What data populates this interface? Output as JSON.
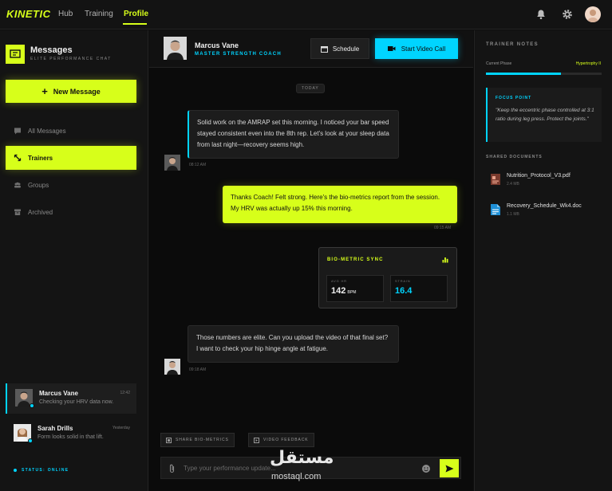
{
  "topbar": {
    "logo": "KINETIC",
    "nav": [
      {
        "label": "Hub"
      },
      {
        "label": "Training"
      },
      {
        "label": "Profile"
      }
    ]
  },
  "sidebar": {
    "title": "Messages",
    "subtitle": "ELITE PERFORMANCE CHAT",
    "new_message": "New Message",
    "items": [
      {
        "label": "All Messages",
        "icon": "chat-icon"
      },
      {
        "label": "Trainers",
        "icon": "arrows-diagonal-icon"
      },
      {
        "label": "Groups",
        "icon": "groups-icon"
      },
      {
        "label": "Archived",
        "icon": "archive-icon"
      }
    ],
    "conversations": [
      {
        "name": "Marcus Vane",
        "time": "12:42",
        "preview": "Checking your HRV data now."
      },
      {
        "name": "Sarah Drills",
        "time": "Yesterday",
        "preview": "Form looks solid in that lift."
      }
    ],
    "status": "STATUS: ONLINE"
  },
  "chat": {
    "header": {
      "name": "Marcus Vane",
      "role": "MASTER STRENGTH COACH",
      "schedule": "Schedule",
      "video": "Start Video Call"
    },
    "day_label": "TODAY",
    "messages": [
      {
        "text": "Solid work on the AMRAP set this morning. I noticed your bar speed stayed consistent even into the 8th rep. Let's look at your sleep data from last night—recovery seems high.",
        "time": "08:12 AM"
      },
      {
        "text": "Thanks Coach! Felt strong. Here's the bio-metrics report from the session. My HRV was actually up 15% this morning.",
        "time": "09:15 AM"
      },
      {
        "text": "Those numbers are elite. Can you upload the video of that final set? I want to check your hip hinge angle at fatigue.",
        "time": "09:18 AM"
      }
    ],
    "bio_card": {
      "title": "BIO-METRIC SYNC",
      "metrics": [
        {
          "label": "AVG HR",
          "value": "142",
          "unit": "BPM"
        },
        {
          "label": "STRAIN",
          "value": "16.4",
          "unit": ""
        }
      ]
    },
    "actions": [
      {
        "label": "SHARE BIO-METRICS"
      },
      {
        "label": "VIDEO FEEDBACK"
      }
    ],
    "input_placeholder": "Type your performance update..."
  },
  "notes": {
    "title": "TRAINER NOTES",
    "phase_label": "Current Phase",
    "phase_value": "Hypertrophy II",
    "phase_progress": 0.65,
    "focus_label": "FOCUS POINT",
    "focus_quote": "\"Keep the eccentric phase controlled at 3:1 ratio during leg press. Protect the joints.\"",
    "docs_title": "SHARED DOCUMENTS",
    "docs": [
      {
        "name": "Nutrition_Protocol_V3.pdf",
        "size": "2.4 MB"
      },
      {
        "name": "Recovery_Schedule_Wk4.doc",
        "size": "1.1 MB"
      }
    ]
  },
  "watermark": {
    "arabic": "مستقل",
    "latin": "mostaql.com"
  },
  "colors": {
    "accent": "#d7ff1a",
    "cyan": "#00d4ff",
    "bg": "#0e0e0e"
  }
}
